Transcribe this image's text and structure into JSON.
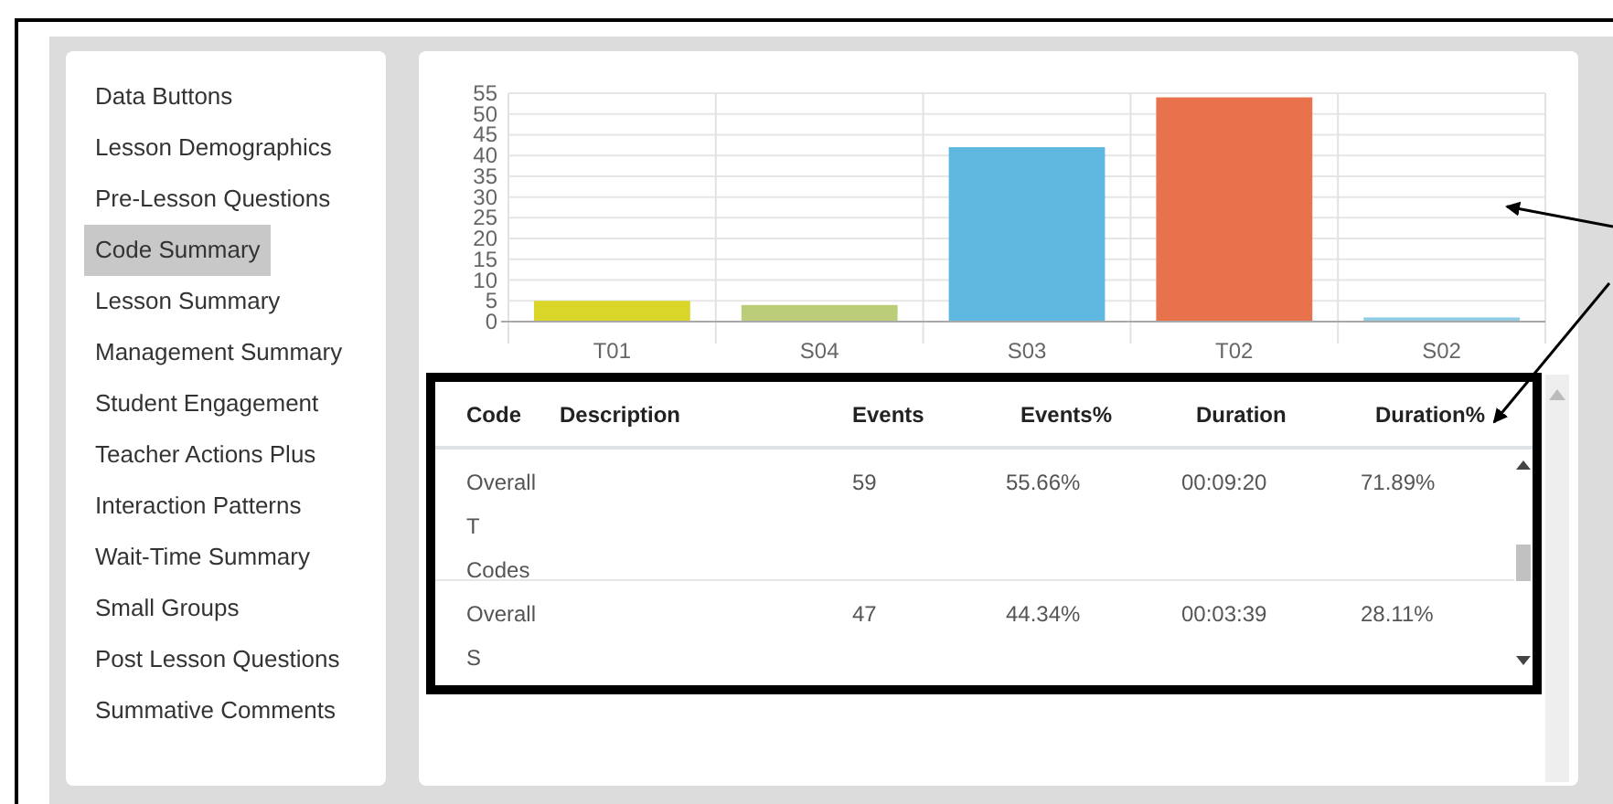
{
  "sidebar": {
    "items": [
      {
        "label": "Data Buttons",
        "selected": false
      },
      {
        "label": "Lesson Demographics",
        "selected": false
      },
      {
        "label": "Pre-Lesson Questions",
        "selected": false
      },
      {
        "label": "Code Summary",
        "selected": true
      },
      {
        "label": "Lesson Summary",
        "selected": false
      },
      {
        "label": "Management Summary",
        "selected": false
      },
      {
        "label": "Student Engagement",
        "selected": false
      },
      {
        "label": "Teacher Actions Plus",
        "selected": false
      },
      {
        "label": "Interaction Patterns",
        "selected": false
      },
      {
        "label": "Wait-Time Summary",
        "selected": false
      },
      {
        "label": "Small Groups",
        "selected": false
      },
      {
        "label": "Post Lesson Questions",
        "selected": false
      },
      {
        "label": "Summative Comments",
        "selected": false
      }
    ]
  },
  "chart": {
    "chart_data": {
      "type": "bar",
      "categories": [
        "T01",
        "S04",
        "S03",
        "T02",
        "S02"
      ],
      "series": [
        {
          "values": [
            5,
            4,
            42,
            54,
            1
          ]
        }
      ],
      "colors": [
        "#d9d629",
        "#bccd7a",
        "#5fb8df",
        "#e8724c",
        "#8ecde3"
      ],
      "ylim": [
        0,
        55
      ],
      "grid": true,
      "yticks": [
        0,
        5,
        10,
        15,
        20,
        25,
        30,
        35,
        40,
        45,
        50,
        55
      ]
    }
  },
  "table": {
    "columns": [
      "Code",
      "Description",
      "Events",
      "Events%",
      "Duration",
      "Duration%"
    ],
    "rows": [
      [
        "Overall T Codes",
        "",
        "59",
        "55.66%",
        "00:09:20",
        "71.89%"
      ],
      [
        "Overall S",
        "",
        "47",
        "44.34%",
        "00:03:39",
        "28.11%"
      ]
    ]
  }
}
